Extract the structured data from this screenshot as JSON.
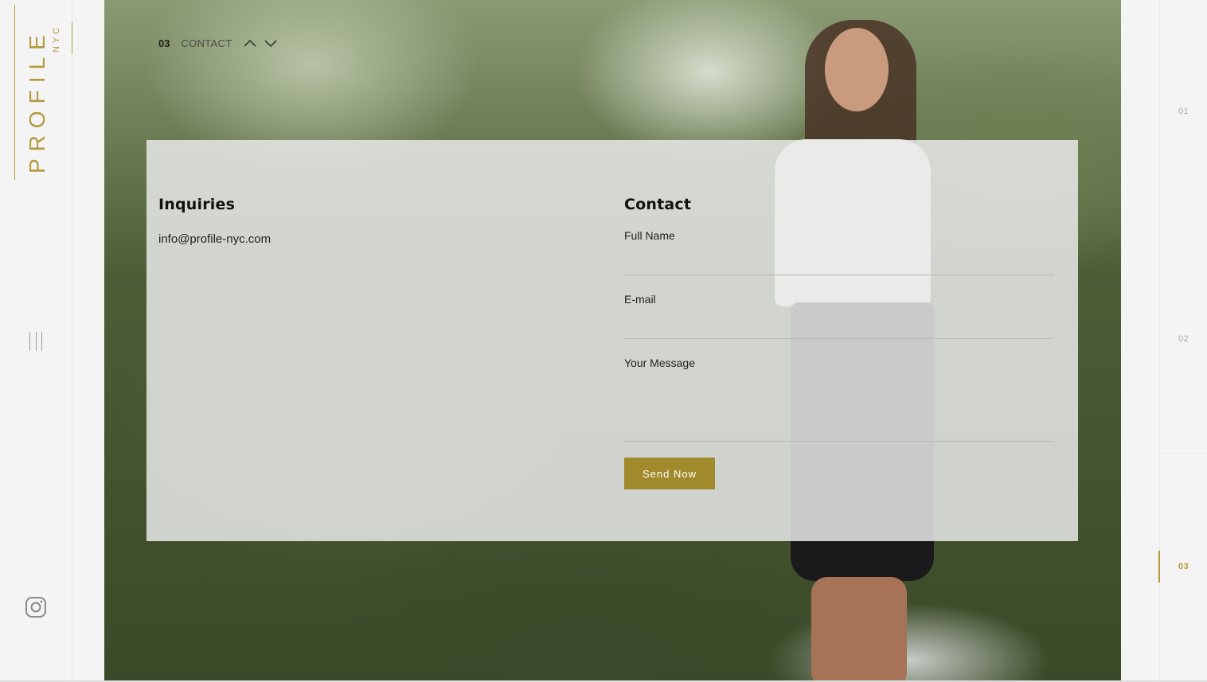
{
  "brand": {
    "logo_main": "PROFILE",
    "logo_sub": "NYC"
  },
  "section_nav": {
    "number": "03",
    "label": "CONTACT",
    "up_icon": "chevron-up-icon",
    "down_icon": "chevron-down-icon"
  },
  "inquiries": {
    "heading": "Inquiries",
    "email": "info@profile-nyc.com"
  },
  "contact_form": {
    "heading": "Contact",
    "full_name_label": "Full Name",
    "full_name_value": "",
    "email_label": "E-mail",
    "email_value": "",
    "message_label": "Your Message",
    "message_value": "",
    "submit_label": "Send Now"
  },
  "side_pager": {
    "slots": [
      {
        "label": "01",
        "active": false
      },
      {
        "label": "02",
        "active": false
      },
      {
        "label": "03",
        "active": true
      }
    ]
  },
  "social": {
    "instagram_icon": "instagram-icon"
  },
  "colors": {
    "accent": "#a08a2b",
    "logo_gold": "#b39a3a",
    "background": "#f4f4f4",
    "panel": "#e8e8e8"
  }
}
